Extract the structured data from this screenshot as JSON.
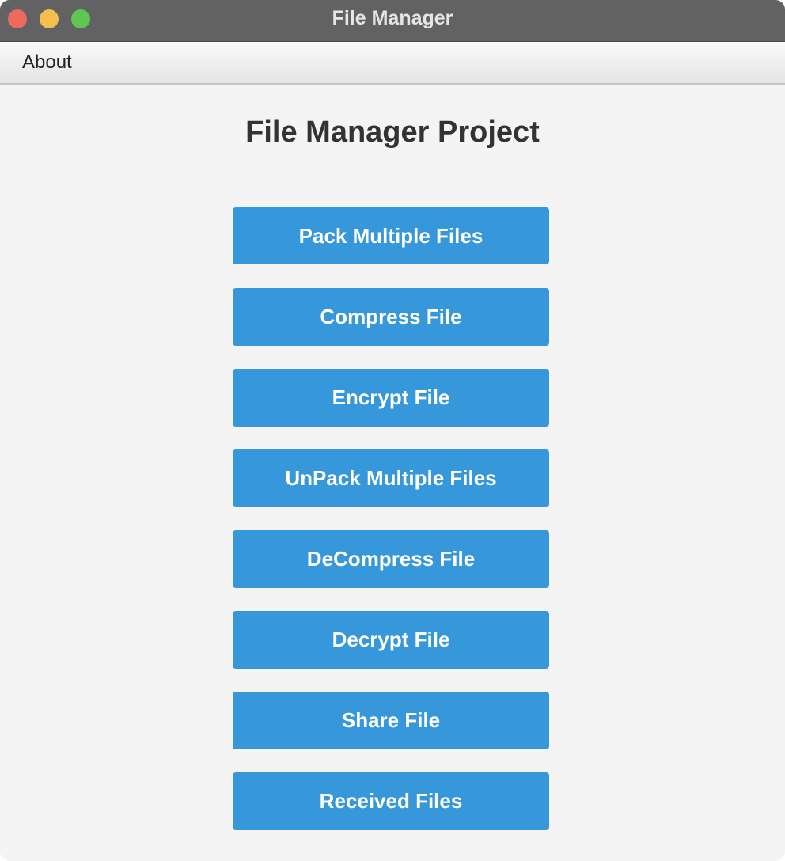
{
  "window": {
    "title": "File Manager"
  },
  "menubar": {
    "items": [
      {
        "label": "About"
      }
    ]
  },
  "main": {
    "heading": "File Manager Project",
    "buttons": [
      {
        "label": "Pack Multiple Files"
      },
      {
        "label": "Compress File"
      },
      {
        "label": "Encrypt File"
      },
      {
        "label": "UnPack Multiple Files"
      },
      {
        "label": "DeCompress File"
      },
      {
        "label": "Decrypt File"
      },
      {
        "label": "Share File"
      },
      {
        "label": "Received Files"
      }
    ]
  },
  "colors": {
    "button_bg": "#3797db",
    "button_text": "#ffffff",
    "titlebar_bg": "#626262",
    "content_bg": "#f4f4f4",
    "traffic_close": "#ec6a5e",
    "traffic_minimize": "#f4bf4f",
    "traffic_zoom": "#61c554"
  }
}
